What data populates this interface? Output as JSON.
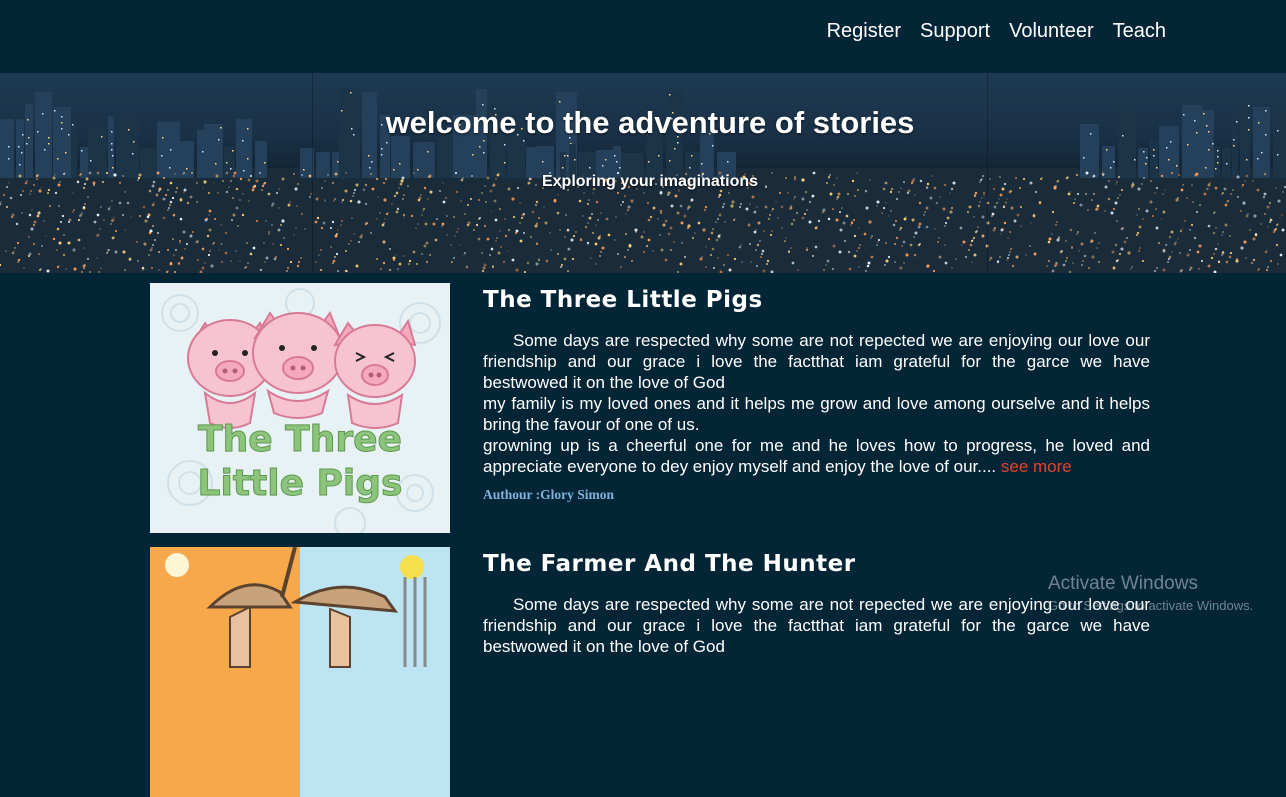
{
  "nav": {
    "items": [
      {
        "label": "Register"
      },
      {
        "label": "Support"
      },
      {
        "label": "Volunteer"
      },
      {
        "label": "Teach"
      }
    ]
  },
  "hero": {
    "title": "welcome to the adventure of stories",
    "subtitle": "Exploring your imaginations"
  },
  "stories": [
    {
      "title": "The Three Little Pigs",
      "image_text": [
        "The Three",
        "Little Pigs"
      ],
      "para1": "Some days are respected why some are not repected we are enjoying our love our friendship and our grace i love the factthat iam grateful for the garce we have bestwowed it on the love of God",
      "para2": "my family is my loved ones and it helps me grow and love among ourselve and it helps bring the favour of one of us.",
      "para3": "growning up is a cheerful one for me and he loves how to progress, he loved and appreciate everyone to dey enjoy myself and enjoy the love of our....",
      "see_more": "see more",
      "author": "Authour :Glory Simon"
    },
    {
      "title": "The Farmer And The Hunter",
      "para1": "Some days are respected why some are not repected we are enjoying our love our friendship and our grace i love the factthat iam grateful for the garce we have bestwowed it on the love of God"
    }
  ],
  "watermark": {
    "line1": "Activate Windows",
    "line2": "Go to Settings to activate Windows."
  },
  "colors": {
    "background": "#042536",
    "link_accent": "#e8412b",
    "author": "#7fb3dd"
  }
}
